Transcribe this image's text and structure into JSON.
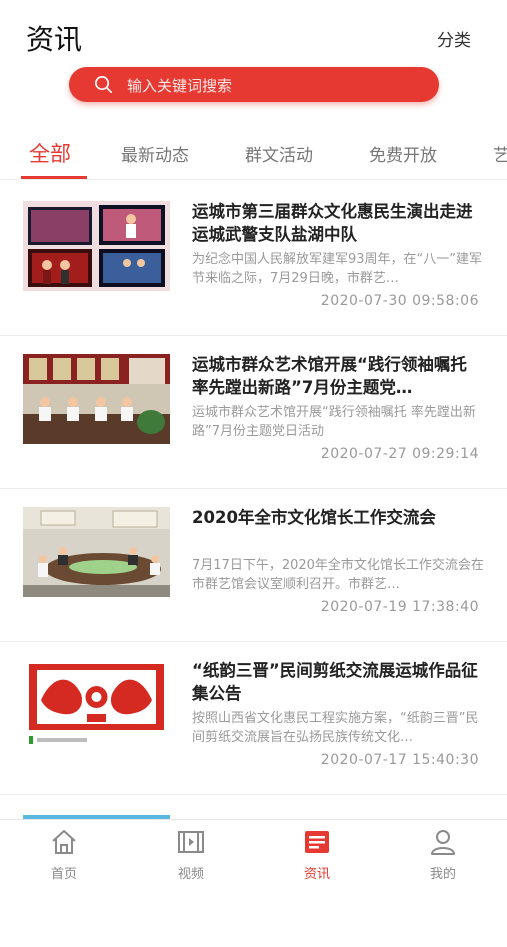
{
  "header": {
    "title": "资讯",
    "category_label": "分类"
  },
  "search": {
    "placeholder": "输入关键词搜索"
  },
  "tabs": [
    "全部",
    "最新动态",
    "群文活动",
    "免费开放",
    "艺"
  ],
  "articles": [
    {
      "title": "运城市第三届群众文化惠民生演出走进运城武警支队盐湖中队",
      "summary": "为纪念中国人民解放军建军93周年，在“八一”建军节来临之际，7月29日晚，市群艺…",
      "time": "2020-07-30 09:58:06",
      "image": "performance-collage"
    },
    {
      "title": "运城市群众艺术馆开展“践行领袖嘱托 率先蹚出新路”7月份主题党…",
      "summary": "运城市群众艺术馆开展“践行领袖嘱托 率先蹚出新路”7月份主题党日活动",
      "time": "2020-07-27 09:29:14",
      "image": "meeting-room"
    },
    {
      "title": "2020年全市文化馆长工作交流会",
      "summary": "7月17日下午，2020年全市文化馆长工作交流会在市群艺馆会议室顺利召开。市群艺…",
      "time": "2020-07-19 17:38:40",
      "image": "conference"
    },
    {
      "title": "“纸韵三晋”民间剪纸交流展运城作品征集公告",
      "summary": "按照山西省文化惠民工程实施方案，“纸韵三晋”民间剪纸交流展旨在弘扬民族传统文化…",
      "time": "2020-07-17 15:40:30",
      "image": "paper-cutting"
    }
  ],
  "bottom_nav": [
    {
      "label": "首页",
      "icon": "home-icon"
    },
    {
      "label": "视频",
      "icon": "video-icon"
    },
    {
      "label": "资讯",
      "icon": "news-icon"
    },
    {
      "label": "我的",
      "icon": "profile-icon"
    }
  ],
  "colors": {
    "accent": "#e53932",
    "muted": "#9a9a9a"
  }
}
